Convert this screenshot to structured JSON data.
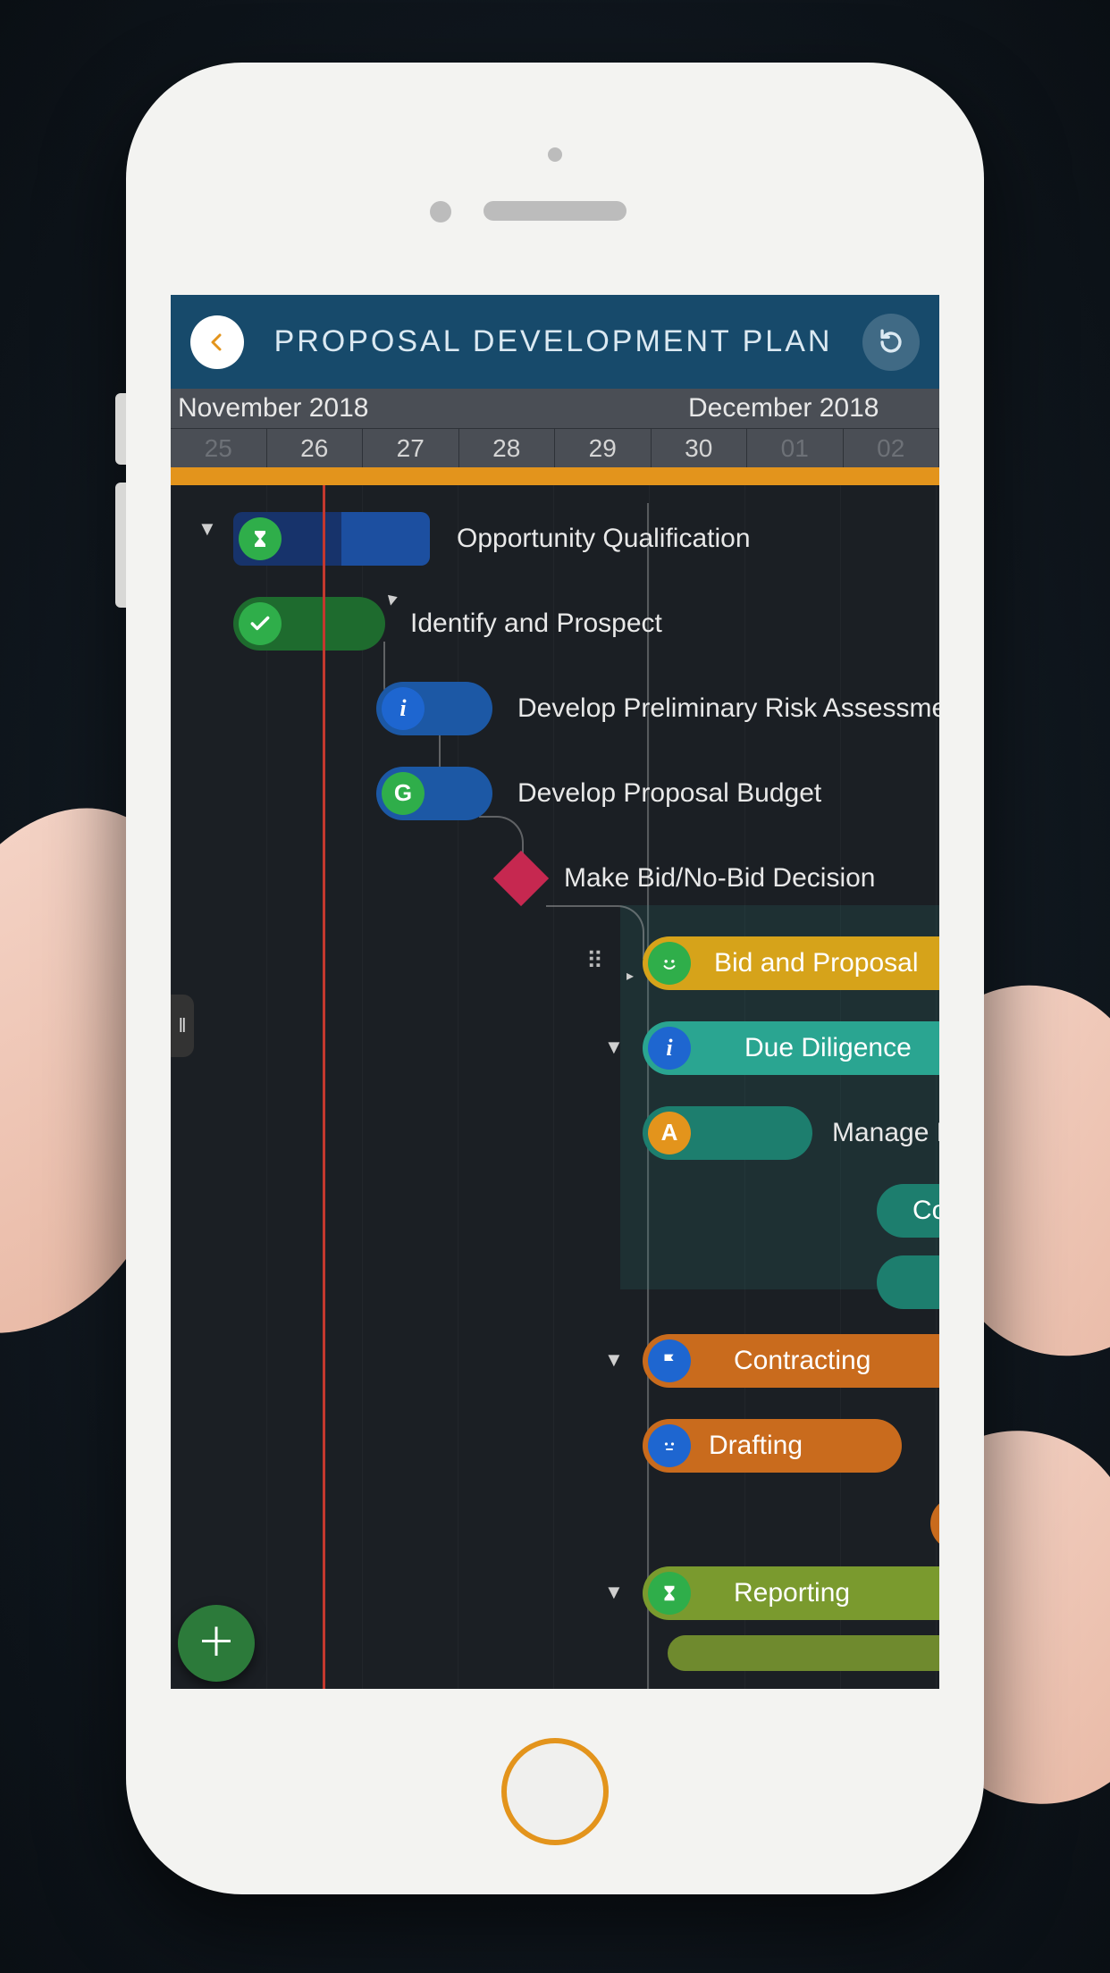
{
  "header": {
    "title": "PROPOSAL DEVELOPMENT PLAN"
  },
  "ruler": {
    "month_left": "November 2018",
    "month_right": "December 2018",
    "days": [
      "25",
      "26",
      "27",
      "28",
      "29",
      "30",
      "01",
      "02"
    ]
  },
  "tasks": {
    "t0": {
      "label": "Opportunity Qualification",
      "icon": "hourglass"
    },
    "t1": {
      "label": "Identify and Prospect",
      "icon": "check"
    },
    "t2": {
      "label": "Develop Preliminary Risk Assessment",
      "icon": "i"
    },
    "t3": {
      "label": "Develop Proposal Budget",
      "icon": "G"
    },
    "t4": {
      "label": "Make Bid/No-Bid Decision"
    },
    "t5": {
      "label": "Bid and Proposal",
      "icon": "smile"
    },
    "t6": {
      "label": "Due Diligence",
      "icon": "i"
    },
    "t7": {
      "label": "Manage Due Dilig",
      "icon": "A"
    },
    "t8": {
      "label": "Co"
    },
    "t10": {
      "label": "Contracting",
      "icon": "flag"
    },
    "t11": {
      "label": "Drafting",
      "icon": "neutral"
    },
    "t12": {
      "label": "Reporting",
      "icon": "hourglass"
    }
  },
  "colors": {
    "header": "#174a6b",
    "accent_orange": "#e3941c",
    "blue_bar": "#1c58a5",
    "darkblue_bar": "#17336b",
    "green_bar": "#1e6b2e",
    "teal_bar": "#2aa591",
    "teal_dark": "#1d7e6e",
    "olive_bar": "#6f8a2e",
    "orange_bar": "#c96b1d",
    "yellow_bar": "#d6a31a",
    "status_green": "#2fae4a",
    "status_blue": "#1e66d0",
    "status_orange": "#e3941c"
  }
}
